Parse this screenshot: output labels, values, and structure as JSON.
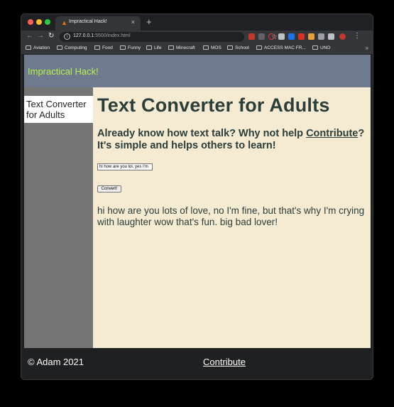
{
  "browser": {
    "tab_title": "Impractical Hack!",
    "tab_close": "×",
    "new_tab": "+",
    "url_host": "127.0.0.1",
    "url_rest": ":5500/index.html",
    "bookmarks": [
      "Aviation",
      "Computing",
      "Food",
      "Funny",
      "Life",
      "Minecraft",
      "MOS",
      "School",
      "ACCESS MAC FR...",
      "UNO"
    ],
    "bookmarks_more": "»",
    "icons": [
      "back-icon",
      "forward-icon",
      "reload-icon",
      "info-icon",
      "star-icon",
      "extensions-icon",
      "menu-icon"
    ]
  },
  "site": {
    "logo": "Impractical Hack!",
    "sidebar": {
      "active_item": "Text Converter for Adults"
    },
    "main": {
      "title": "Text Converter for Adults",
      "intro_before": "Already know how text talk? Why not help",
      "intro_link": "Contribute",
      "intro_after": "? It's simple and helps others to learn!",
      "input_value": "hi how are you lol, yes I'm",
      "button_label": "Convert!",
      "output": "hi how are you lots of love, no I'm fine, but that's why I'm crying with laughter wow that's fun. big bad lover!"
    },
    "footer": {
      "copyright": "© Adam 2021",
      "link": "Contribute"
    }
  },
  "colors": {
    "header_bg": "#6f7a8f",
    "logo": "#b7f24b",
    "sidebar_bg": "#757575",
    "main_bg": "#f5ead2",
    "heading": "#2c3e3a",
    "footer_bg": "#1f2022"
  }
}
